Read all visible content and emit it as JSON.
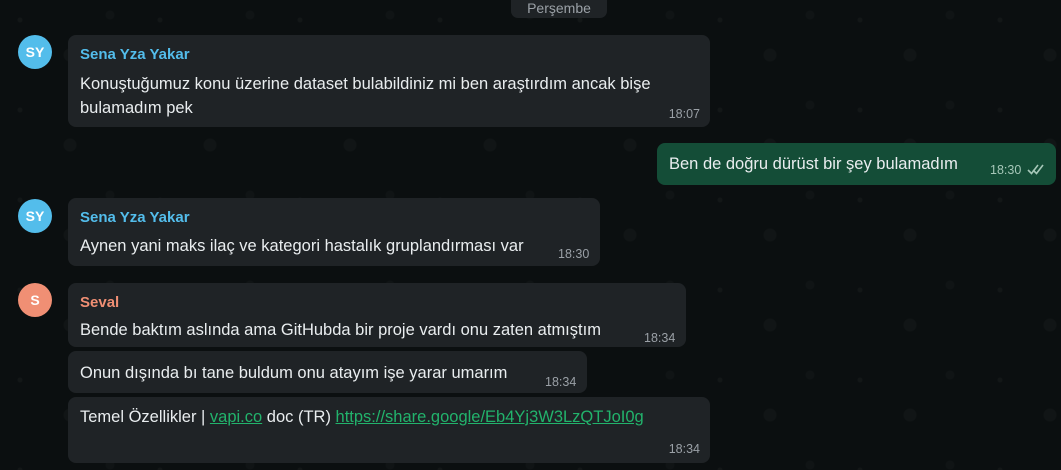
{
  "day_separator": "Perşembe",
  "messages": [
    {
      "avatar": "SY",
      "sender": "Sena Yza Yakar",
      "text_line1": "Konuştuğumuz konu üzerine dataset bulabildiniz mi ben araştırdım ancak bişe",
      "text_line2": "bulamadım pek",
      "time": "18:07"
    },
    {
      "text": "Ben de doğru dürüst bir şey bulamadım",
      "time": "18:30",
      "status_icon": "double-check-icon"
    },
    {
      "avatar": "SY",
      "sender": "Sena Yza Yakar",
      "text": "Aynen yani maks ilaç ve kategori hastalık gruplandırması var",
      "time": "18:30"
    },
    {
      "avatar": "S",
      "sender": "Seval",
      "text": "Bende baktım aslında ama GitHubda bir proje vardı onu zaten atmıştım",
      "time": "18:34"
    },
    {
      "text": "Onun dışında bı tane buldum onu atayım işe yarar umarım",
      "time": "18:34"
    },
    {
      "text_prefix": "Temel Özellikler | ",
      "link1": "vapi.co",
      "text_middle": " doc (TR) ",
      "link2": "https://share.google/Eb4Yj3W3LzQTJoI0g",
      "time": "18:34"
    }
  ],
  "colors": {
    "background": "#0b0f10",
    "incoming_bubble": "#1f2326",
    "outgoing_bubble": "#144d37",
    "sender_sena": "#53bdeb",
    "sender_seval": "#f08f74",
    "link": "#22b36c"
  }
}
